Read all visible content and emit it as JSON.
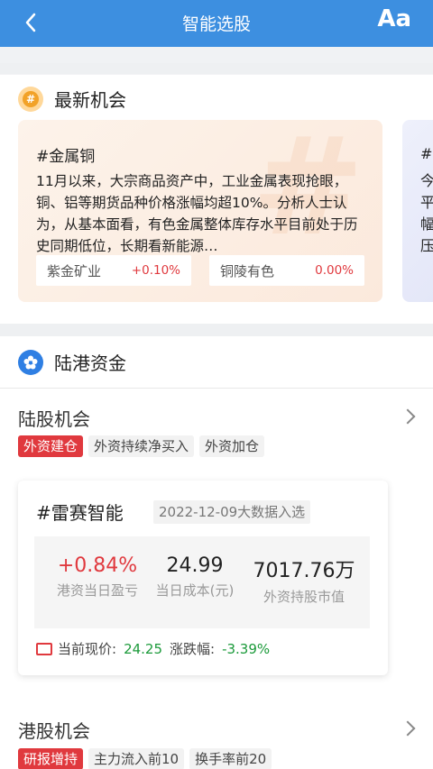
{
  "header": {
    "title": "智能选股",
    "font_button": "Aa"
  },
  "section_latest": {
    "title": "最新机会",
    "card": {
      "topic": "#金属铜",
      "text": "11月以来，大宗商品资产中，工业金属表现抢眼，铜、铝等期货品种价格涨幅均超10%。分析人士认为，从基本面看，有色金属整体库存水平目前处于历史同期低位，长期看新能源…",
      "stocks": [
        {
          "name": "紫金矿业",
          "change": "+0.10%"
        },
        {
          "name": "铜陵有色",
          "change": "0.00%"
        }
      ]
    },
    "next_card_peek": [
      "#",
      "今",
      "平",
      "幅",
      "压"
    ]
  },
  "section_capital": {
    "title": "陆港资金",
    "mainland": {
      "title": "陆股机会",
      "tags": [
        "外资建仓",
        "外资持续净买入",
        "外资加仓"
      ],
      "stock": {
        "name": "#雷赛智能",
        "date_tag": "2022-12-09大数据入选",
        "metrics": [
          {
            "value": "+0.84%",
            "label": "港资当日盈亏"
          },
          {
            "value": "24.99",
            "label": "当日成本(元)"
          },
          {
            "value": "7017.76万",
            "label": "外资持股市值"
          }
        ],
        "price_label": "当前现价:",
        "price": "24.25",
        "change_label": "涨跌幅:",
        "change": "-3.39%"
      }
    },
    "hk": {
      "title": "港股机会",
      "tags": [
        "研报增持",
        "主力流入前10",
        "换手率前20"
      ]
    }
  }
}
